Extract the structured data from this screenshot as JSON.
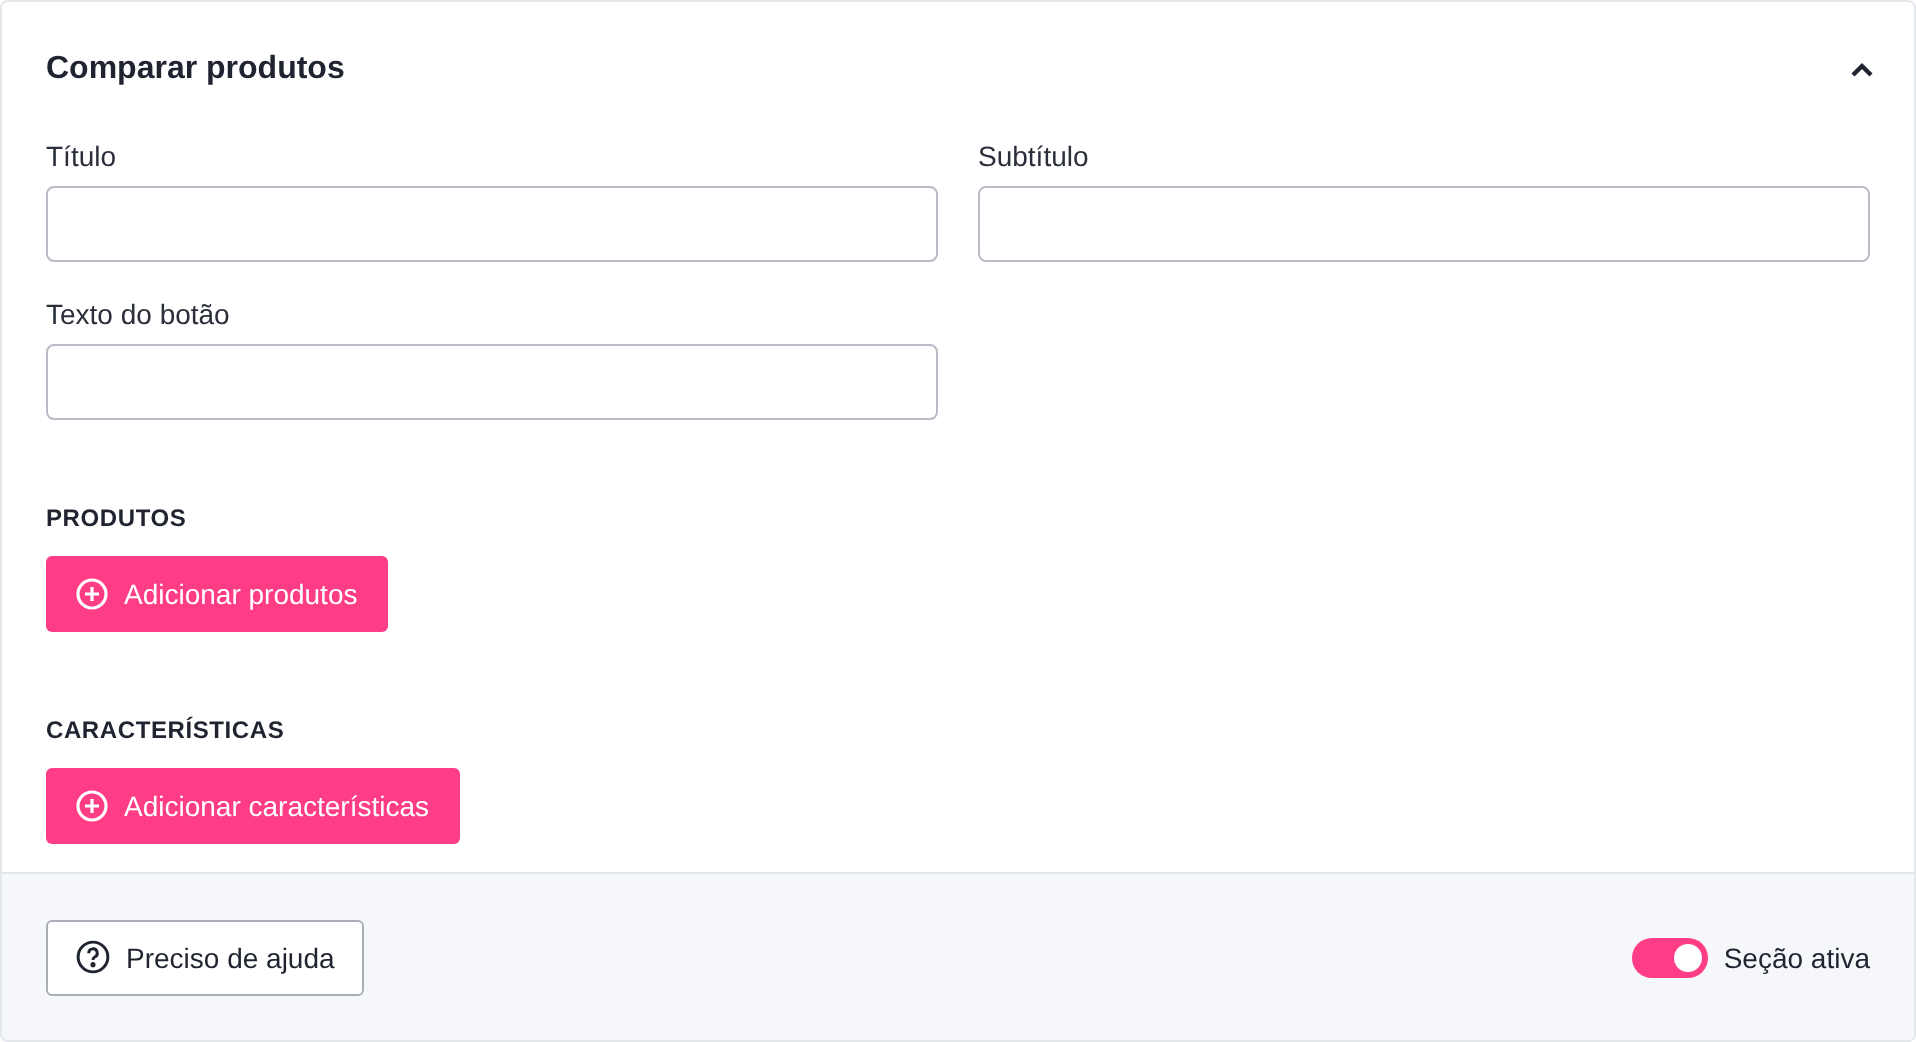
{
  "panel": {
    "title": "Comparar produtos",
    "expanded": true
  },
  "fields": [
    {
      "label": "Título"
    },
    {
      "label": "Subtítulo"
    },
    {
      "label": "Texto do botão"
    }
  ],
  "sections": [
    {
      "heading": "PRODUTOS",
      "button": "Adicionar produtos"
    },
    {
      "heading": "CARACTERÍSTICAS",
      "button": "Adicionar características"
    }
  ],
  "footer": {
    "help_button": "Preciso de ajuda",
    "toggle": {
      "label": "Seção ativa",
      "on": true
    }
  }
}
